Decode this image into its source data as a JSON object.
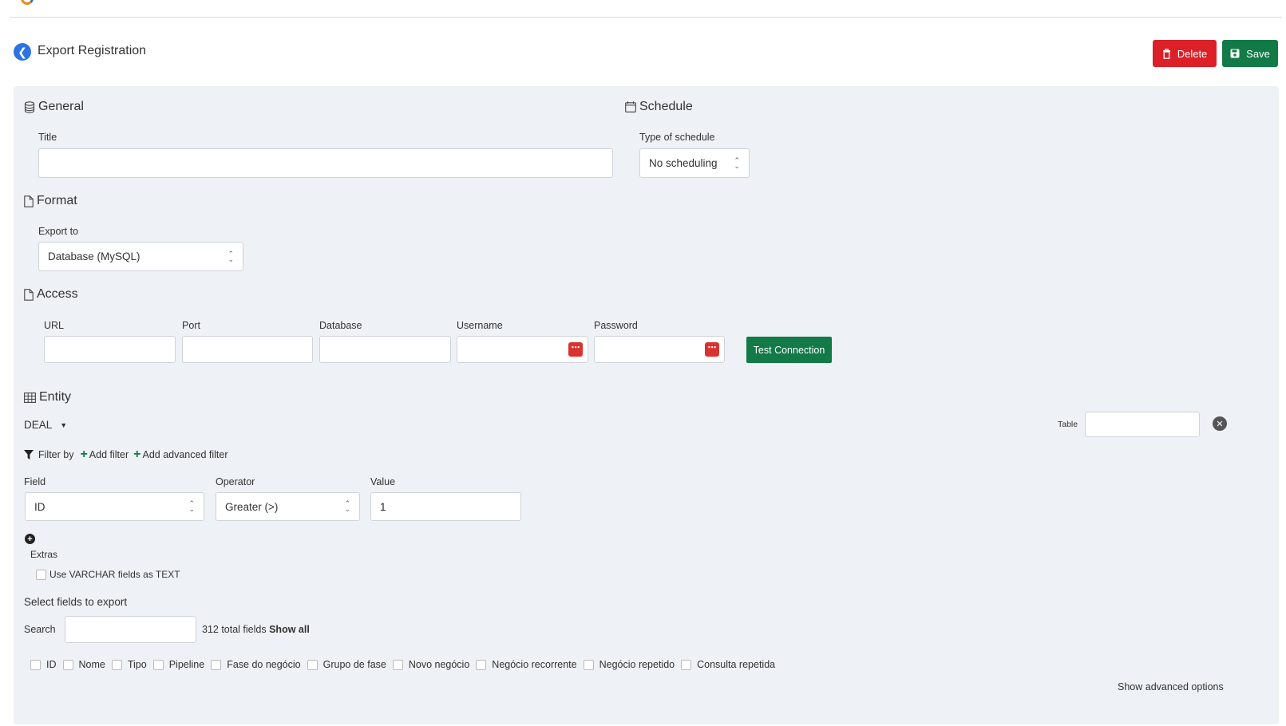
{
  "colors": {
    "primary": "#2b74e2",
    "danger": "#dc2027",
    "success": "#117a47",
    "panel_bg": "#eef1f5"
  },
  "header": {
    "title": "Export Registration",
    "back_icon": "chevron-left-icon",
    "delete_label": "Delete",
    "save_label": "Save"
  },
  "general": {
    "heading": "General",
    "title_label": "Title",
    "title_value": ""
  },
  "schedule": {
    "heading": "Schedule",
    "type_label": "Type of schedule",
    "type_value": "No scheduling"
  },
  "format": {
    "heading": "Format",
    "export_to_label": "Export to",
    "export_to_value": "Database (MySQL)"
  },
  "access": {
    "heading": "Access",
    "url_label": "URL",
    "port_label": "Port",
    "database_label": "Database",
    "username_label": "Username",
    "password_label": "Password",
    "test_connection_label": "Test Connection"
  },
  "entity": {
    "heading": "Entity",
    "selected": "DEAL",
    "table_label": "Table",
    "table_value": ""
  },
  "filter": {
    "filter_by_label": "Filter by",
    "add_filter_label": "Add filter",
    "add_advanced_filter_label": "Add advanced filter",
    "field_label": "Field",
    "field_value": "ID",
    "operator_label": "Operator",
    "operator_value": "Greater (>)",
    "value_label": "Value",
    "value_value": "1"
  },
  "extras": {
    "label": "Extras",
    "varchar_label": "Use VARCHAR fields as TEXT"
  },
  "fields": {
    "heading": "Select fields to export",
    "search_label": "Search",
    "total_text": "312 total fields",
    "show_all_label": "Show all",
    "items": [
      "ID",
      "Nome",
      "Tipo",
      "Pipeline",
      "Fase do negócio",
      "Grupo de fase",
      "Novo negócio",
      "Negócio recorrente",
      "Negócio repetido",
      "Consulta repetida"
    ],
    "advanced_label": "Show advanced options"
  }
}
